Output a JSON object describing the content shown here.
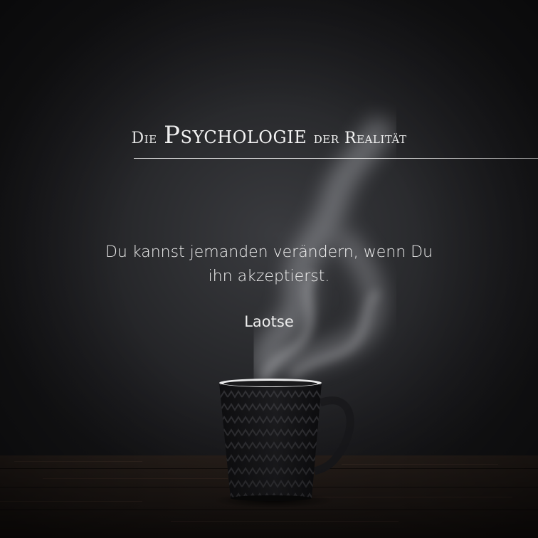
{
  "header": {
    "prefix": "Die",
    "main": "Psychologie",
    "suffix": "der Realität"
  },
  "quote": {
    "line1": "Du kannst jemanden verändern, wenn Du",
    "line2": "ihn akzeptierst."
  },
  "author": "Laotse",
  "colors": {
    "background": "#2a2b2e",
    "text": "#f4f4f4",
    "table": "#2a211c"
  }
}
